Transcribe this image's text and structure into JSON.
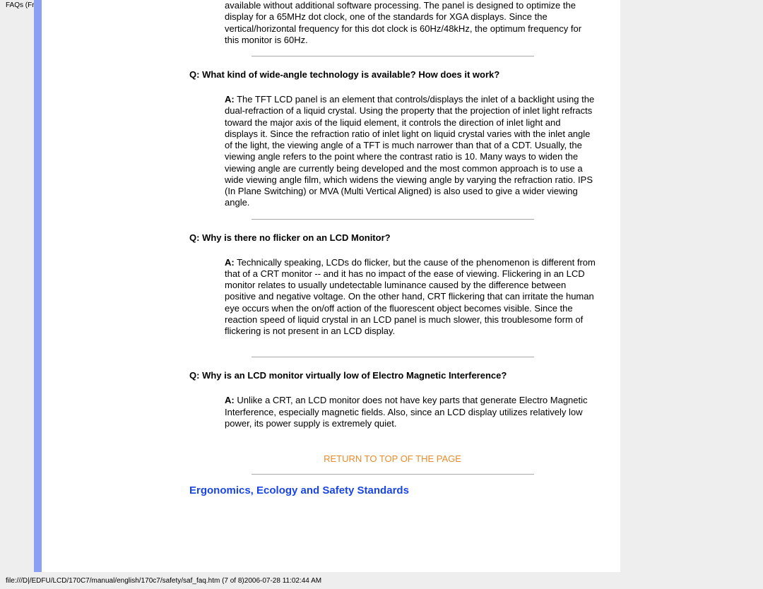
{
  "topTag": "FAQs (Frequently Asked Questions)",
  "intro_para": "available without additional software processing. The panel is designed to optimize the display for a 65MHz dot clock, one of the standards for XGA displays. Since the vertical/horizontal frequency for this dot clock is 60Hz/48kHz, the optimum frequency for this monitor is 60Hz.",
  "q1": {
    "q_label": "Q:",
    "q_text": " What kind of wide-angle technology is available? How does it work?",
    "a_label": "A:",
    "a_text": " The TFT LCD panel is an element that controls/displays the inlet of a backlight using the dual-refraction of a liquid crystal. Using the property that the projection of inlet light refracts toward the major axis of the liquid element, it controls the direction of inlet light and displays it. Since the refraction ratio of inlet light on liquid crystal varies with the inlet angle of the light, the viewing angle of a TFT is much narrower than that of a CDT. Usually, the viewing angle refers to the point where the contrast ratio is 10. Many ways to widen the viewing angle are currently being developed and the most common approach is to use a wide viewing angle film, which widens the viewing angle by varying the refraction ratio. IPS (In Plane Switching) or MVA (Multi Vertical Aligned) is also used to give a wider viewing angle."
  },
  "q2": {
    "q_label": "Q:",
    "q_text": " Why is there no flicker on an LCD Monitor?",
    "a_label": "A:",
    "a_text": " Technically speaking, LCDs do flicker, but the cause of the phenomenon is different from that of a CRT monitor -- and it has no impact of the ease of viewing. Flickering in an LCD monitor relates to usually undetectable luminance caused by the difference between positive and negative voltage. On the other hand, CRT flickering that can irritate the human eye occurs when the on/off action of the fluorescent object becomes visible. Since the reaction speed of liquid crystal in an LCD panel is much slower, this troublesome form of flickering is not present in an LCD display."
  },
  "q3": {
    "q_label": "Q:",
    "q_text": " Why is an LCD monitor virtually low of Electro Magnetic Interference?",
    "a_label": "A:",
    "a_text": " Unlike a CRT, an LCD monitor does not have key parts that generate Electro Magnetic Interference, especially magnetic fields. Also, since an LCD display utilizes relatively low power, its power supply is extremely quiet."
  },
  "return_link": "RETURN TO TOP OF THE PAGE",
  "section_heading": "Ergonomics, Ecology and Safety Standards",
  "footer_path": "file:///D|/EDFU/LCD/170C7/manual/english/170c7/safety/saf_faq.htm (7 of 8)2006-07-28 11:02:44 AM"
}
